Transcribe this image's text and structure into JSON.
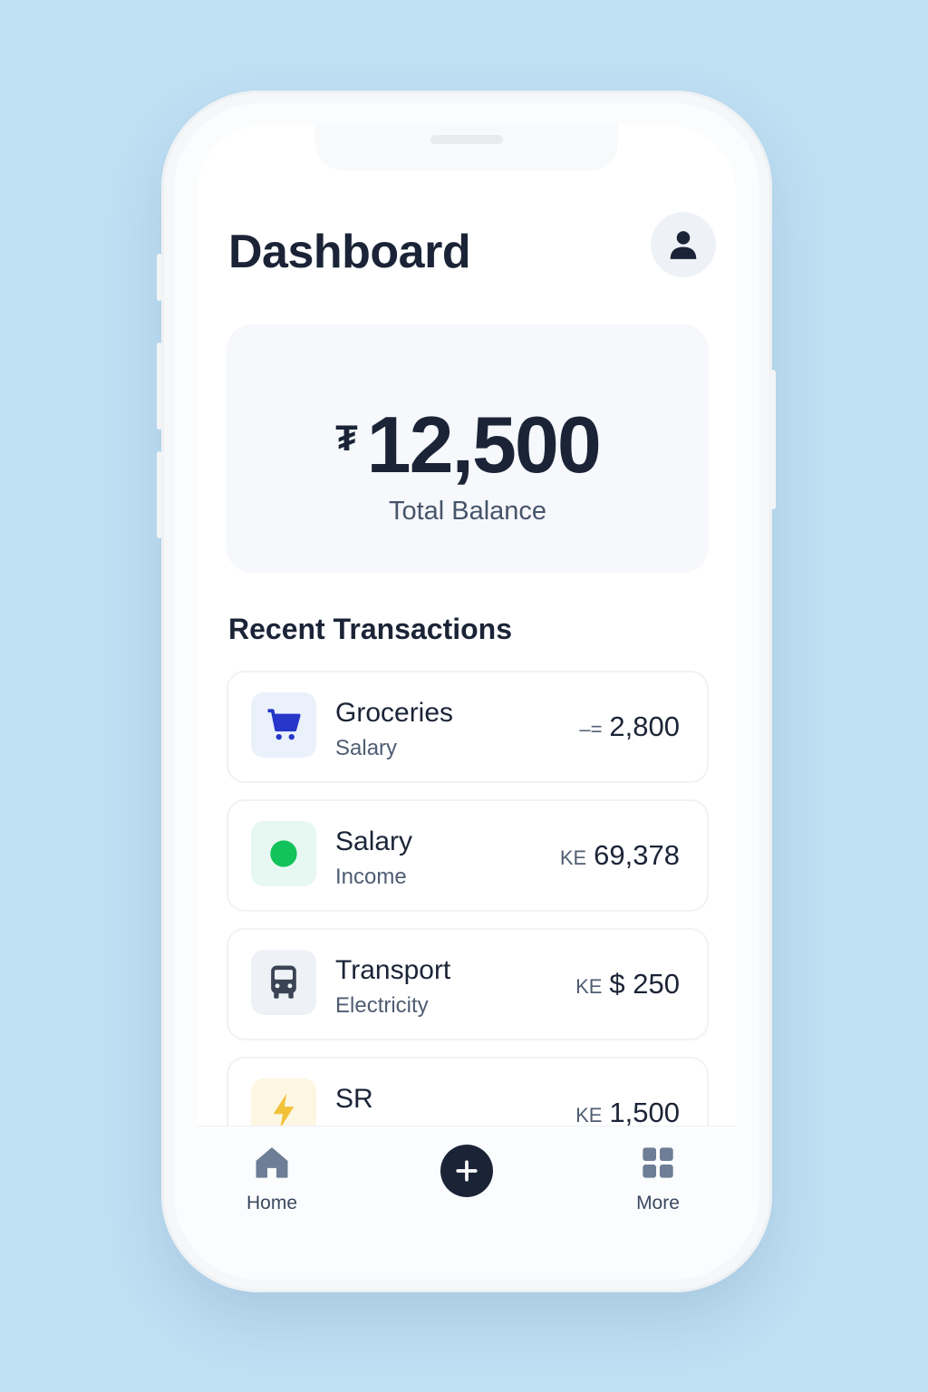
{
  "header": {
    "title": "Dashboard",
    "profile_icon": "user-icon"
  },
  "balance": {
    "currency_symbol": "₮",
    "amount": "12,500",
    "label": "Total Balance"
  },
  "transactions": {
    "title": "Recent Transactions",
    "items": [
      {
        "icon": "cart-icon",
        "icon_color": "#2637c9",
        "icon_bg": "#eaf1fb",
        "name": "Groceries",
        "sub": "Salary",
        "prefix": "–=",
        "amount": "2,800"
      },
      {
        "icon": "dot-icon",
        "icon_color": "#12c25a",
        "icon_bg": "#e6f8f1",
        "name": "Salary",
        "sub": "Income",
        "prefix": "KE",
        "amount": "69,378"
      },
      {
        "icon": "bus-icon",
        "icon_color": "#3b4455",
        "icon_bg": "#eef2f7",
        "name": "Transport",
        "sub": "Electricity",
        "prefix": "KE",
        "amount": "$ 250"
      },
      {
        "icon": "bolt-icon",
        "icon_color": "#f1c238",
        "icon_bg": "#fdf6e3",
        "name": "SR",
        "sub": "",
        "prefix": "KE",
        "amount": "1,500"
      }
    ]
  },
  "tabbar": {
    "home_label": "Home",
    "more_label": "More",
    "home_icon": "home-icon",
    "add_icon": "plus-icon",
    "more_icon": "grid-icon"
  },
  "colors": {
    "background": "#bfdff3",
    "primary_text": "#1b2437",
    "fab": "#1b2437"
  }
}
